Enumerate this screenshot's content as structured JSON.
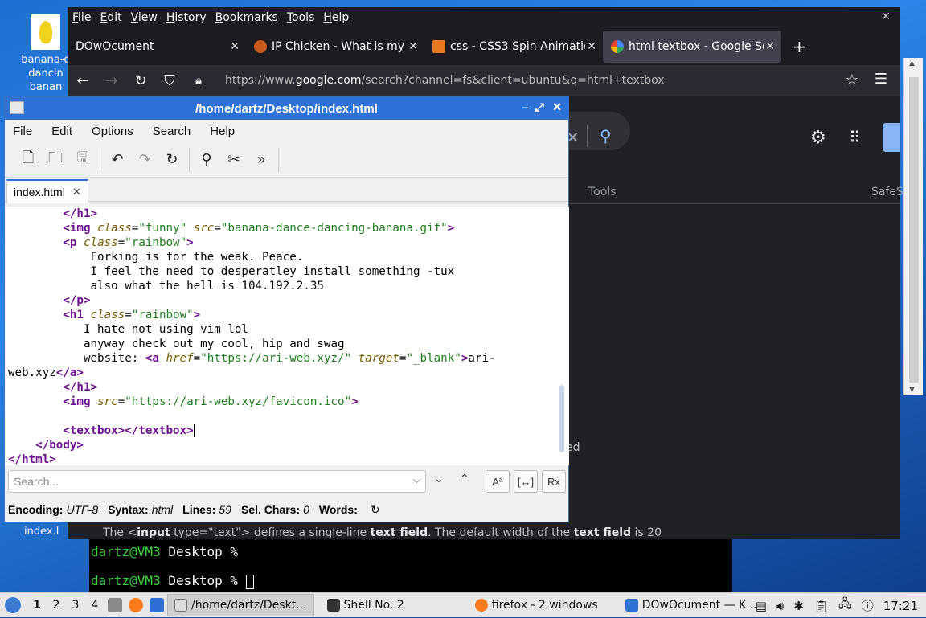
{
  "desktop": {
    "icon_top_label_lines": [
      "banana-d",
      "dancin",
      "banan"
    ],
    "icon_bottom_label": "index.l"
  },
  "firefox": {
    "menu": [
      "File",
      "Edit",
      "View",
      "History",
      "Bookmarks",
      "Tools",
      "Help"
    ],
    "tabs": [
      {
        "label": "DOwOcument",
        "icon": "none"
      },
      {
        "label": "IP Chicken - What is my I",
        "icon": "chicken-icon"
      },
      {
        "label": "css - CSS3 Spin Animatio",
        "icon": "stackoverflow-icon"
      },
      {
        "label": "html textbox - Google Se",
        "icon": "google-icon",
        "active": true
      }
    ],
    "url_prefix": "https://www.",
    "url_domain": "google.com",
    "url_rest": "/search?channel=fs&client=ubuntu&q=html+textbox",
    "google": {
      "tools_label": "Tools",
      "safesearch_label": "SafeS",
      "fragment_text": "ed",
      "snippet_pre": "The <",
      "snippet_b1": "input",
      "snippet_mid": " type=\"text\"> defines a single-line ",
      "snippet_b2": "text field",
      "snippet_mid2": ". The default width of the ",
      "snippet_b3": "text field",
      "snippet_end": " is 20"
    }
  },
  "terminal": {
    "prompt_user": "dartz@VM3",
    "prompt_rest": " Desktop %"
  },
  "editor": {
    "title": "/home/dartz/Desktop/index.html",
    "menu": [
      "File",
      "Edit",
      "Options",
      "Search",
      "Help"
    ],
    "tab_label": "index.html",
    "search_placeholder": "Search...",
    "status": {
      "encoding_label": "Encoding:",
      "encoding": "UTF-8",
      "syntax_label": "Syntax:",
      "syntax": "html",
      "lines_label": "Lines:",
      "lines": "59",
      "sel_label": "Sel. Chars:",
      "sel": "0",
      "words_label": "Words:"
    },
    "code": {
      "l1_close_h1": "</h1>",
      "l2_img": "<img",
      "l2_class_attr": "class",
      "l2_class_val": "\"funny\"",
      "l2_src_attr": "src",
      "l2_src_val": "\"banana-dance-dancing-banana.gif\"",
      "l3_p": "<p",
      "l3_class_attr": "class",
      "l3_class_val": "\"rainbow\"",
      "l4": "Forking is for the weak. Peace.",
      "l5": "I feel the need to desperatley install something -tux",
      "l6": "also what the hell is 104.192.2.35",
      "l7_close_p": "</p>",
      "l8_h1": "<h1",
      "l8_class_attr": "class",
      "l8_class_val": "\"rainbow\"",
      "l9": "I hate not using vim lol",
      "l10": "anyway check out my cool, hip and swag",
      "l11_text": "website: ",
      "l11_a": "<a",
      "l11_href_attr": "href",
      "l11_href_val": "\"https://ari-web.xyz/\"",
      "l11_target_attr": "target",
      "l11_target_val": "\"_blank\"",
      "l11_after": "ari-",
      "l12_text": "web.xyz",
      "l12_close_a": "</a>",
      "l13_close_h1": "</h1>",
      "l14_img": "<img",
      "l14_src_attr": "src",
      "l14_src_val": "\"https://ari-web.xyz/favicon.ico\"",
      "l16_textbox": "<textbox></textbox>",
      "l17_close_body": "</body>",
      "l18_close_html": "</html>"
    }
  },
  "taskbar": {
    "workspaces": [
      "1",
      "2",
      "3",
      "4"
    ],
    "buttons": [
      {
        "label": "/home/dartz/Deskt...",
        "active": true
      },
      {
        "label": "Shell No. 2"
      },
      {
        "label": "firefox - 2 windows"
      },
      {
        "label": "DOwOcument — K..."
      }
    ],
    "clock": "17:21"
  },
  "colors": {
    "editor_titlebar": "#2f72d6",
    "firefox_bg": "#1c1b22",
    "tag_color": "#6b0f8f",
    "string_color": "#1d7d1d"
  }
}
